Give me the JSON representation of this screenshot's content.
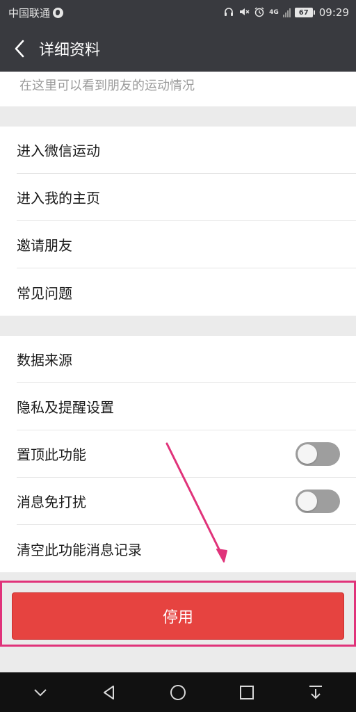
{
  "status_bar": {
    "carrier": "中国联通",
    "network": "4G",
    "battery": "67",
    "time": "09:29"
  },
  "nav": {
    "title": "详细资料"
  },
  "subtitle": "在这里可以看到朋友的运动情况",
  "group1": [
    {
      "label": "进入微信运动"
    },
    {
      "label": "进入我的主页"
    },
    {
      "label": "邀请朋友"
    },
    {
      "label": "常见问题"
    }
  ],
  "group2": [
    {
      "label": "数据来源"
    },
    {
      "label": "隐私及提醒设置"
    },
    {
      "label": "置顶此功能",
      "toggle": false
    },
    {
      "label": "消息免打扰",
      "toggle": false
    },
    {
      "label": "清空此功能消息记录"
    }
  ],
  "button": {
    "label": "停用",
    "color": "#e64340"
  },
  "annotation_color": "#e0337a",
  "icons": [
    "back-chevron-icon",
    "headset-icon",
    "mute-icon",
    "alarm-icon",
    "signal-icon",
    "battery-icon",
    "chevron-down-icon",
    "back-triangle-icon",
    "home-circle-icon",
    "recents-square-icon",
    "notification-pull-icon"
  ]
}
